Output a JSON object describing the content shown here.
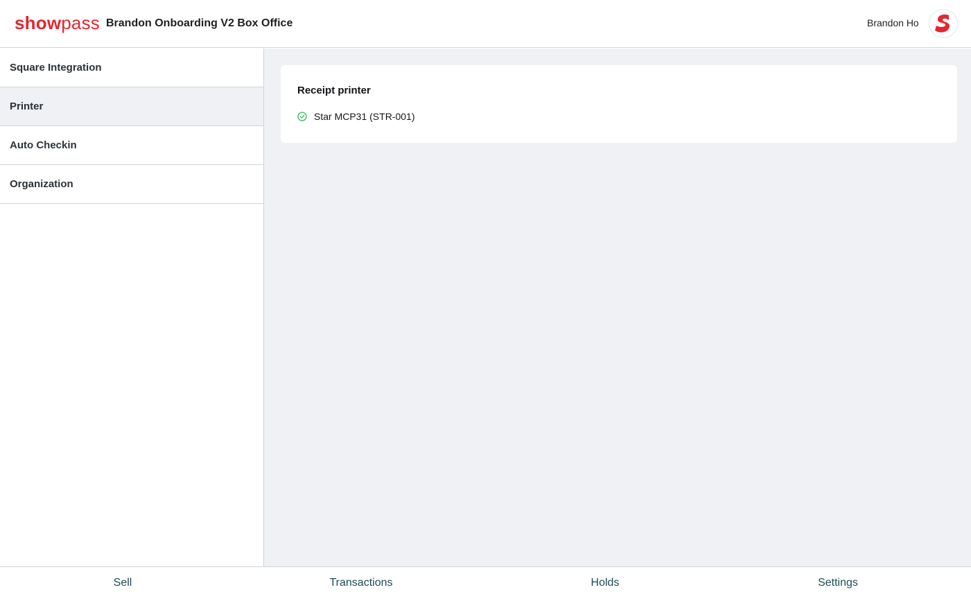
{
  "header": {
    "logo_show": "show",
    "logo_pass": "pass",
    "title": "Brandon Onboarding V2 Box Office",
    "user_name": "Brandon Ho",
    "avatar_icon": "showpass-s-logo-icon",
    "brand_color": "#e5262f"
  },
  "sidebar": {
    "items": [
      {
        "label": "Square Integration",
        "active": false
      },
      {
        "label": "Printer",
        "active": true
      },
      {
        "label": "Auto Checkin",
        "active": false
      },
      {
        "label": "Organization",
        "active": false
      }
    ]
  },
  "main": {
    "card": {
      "title": "Receipt printer",
      "printer_name": "Star MCP31 (STR-001)",
      "status_icon": "check-circle-icon",
      "status_color": "#2ebd59"
    }
  },
  "bottom_nav": {
    "items": [
      {
        "label": "Sell"
      },
      {
        "label": "Transactions"
      },
      {
        "label": "Holds"
      },
      {
        "label": "Settings"
      }
    ]
  }
}
